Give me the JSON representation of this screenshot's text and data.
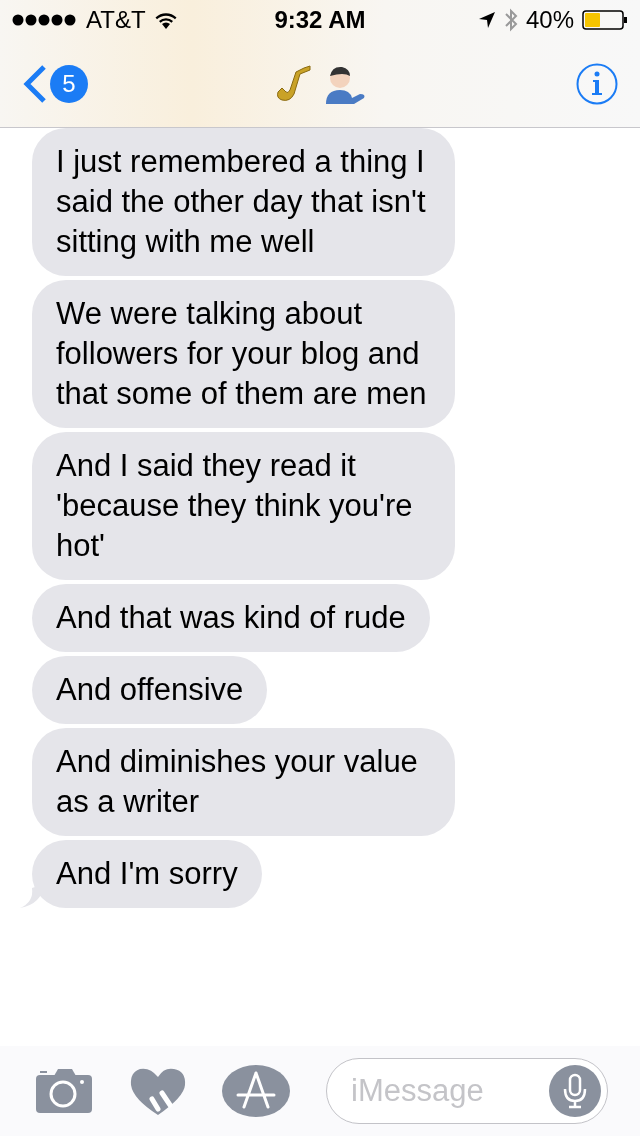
{
  "status_bar": {
    "carrier": "AT&T",
    "time": "9:32 AM",
    "battery": "40%"
  },
  "nav": {
    "unread_count": "5"
  },
  "messages": [
    {
      "text": "I just remembered a thing I said the other day that isn't sitting with me well",
      "tail": false
    },
    {
      "text": "We were talking about followers for your blog and that some of them are men",
      "tail": false
    },
    {
      "text": "And I said they read it 'because they think you're hot'",
      "tail": false
    },
    {
      "text": "And that was kind of rude",
      "tail": false
    },
    {
      "text": "And offensive",
      "tail": false
    },
    {
      "text": "And diminishes your value as a writer",
      "tail": false
    },
    {
      "text": "And I'm sorry",
      "tail": true
    }
  ],
  "composer": {
    "placeholder": "iMessage"
  }
}
